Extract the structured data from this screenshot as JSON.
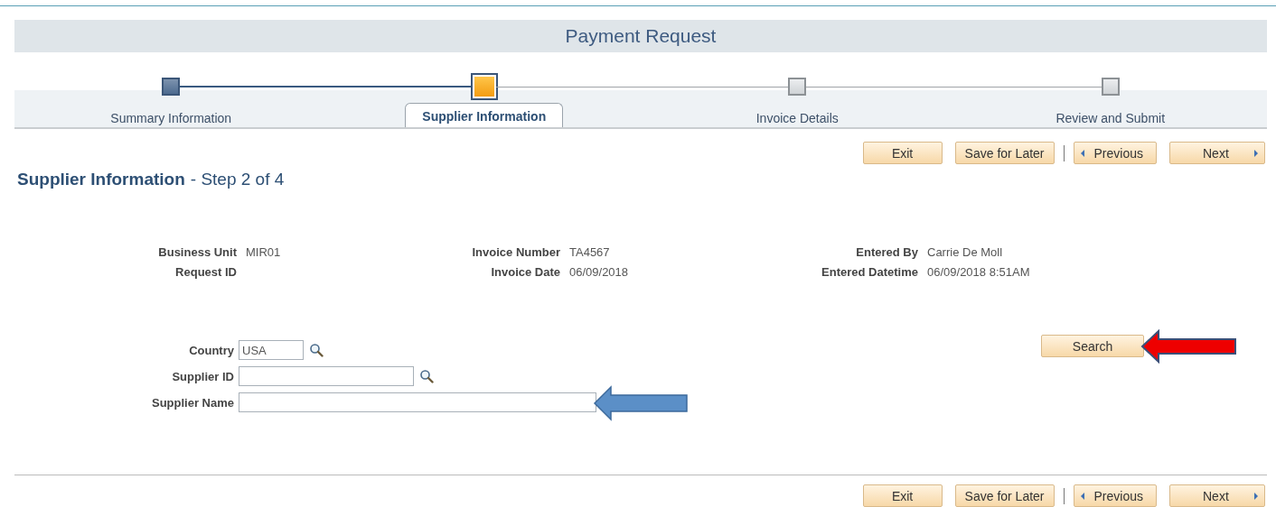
{
  "page_title": "Payment Request",
  "steps": [
    {
      "label": "Summary Information",
      "kind": "done",
      "selected": false
    },
    {
      "label": "Supplier Information",
      "kind": "current",
      "selected": true
    },
    {
      "label": "Invoice Details",
      "kind": "todo",
      "selected": false
    },
    {
      "label": "Review and Submit",
      "kind": "todo",
      "selected": false
    }
  ],
  "top_buttons": [
    {
      "label": "Exit",
      "kind": "plain"
    },
    {
      "label": "Save for Later",
      "kind": "plain"
    },
    {
      "label": "Previous",
      "kind": "prev"
    },
    {
      "label": "Next",
      "kind": "next"
    }
  ],
  "heading": {
    "title": "Supplier Information",
    "subtitle": "- Step 2 of 4"
  },
  "info": [
    {
      "label": "Business Unit",
      "value": "MIR01"
    },
    {
      "label": "Invoice Number",
      "value": "TA4567"
    },
    {
      "label": "Entered By",
      "value": "Carrie De Moll"
    },
    {
      "label": "Request ID"
    },
    {
      "label": "Invoice Date",
      "value": "06/09/2018"
    },
    {
      "label": "Entered Datetime",
      "value": "06/09/2018  8:51AM"
    }
  ],
  "form": [
    {
      "label": "Country",
      "value": "USA",
      "kind": "lookup"
    },
    {
      "label": "Supplier ID",
      "kind": "lookup"
    },
    {
      "label": "Supplier Name",
      "kind": "text"
    }
  ],
  "search_button": "Search",
  "bottom_buttons": [
    {
      "label": "Exit",
      "kind": "plain"
    },
    {
      "label": "Save for Later",
      "kind": "plain"
    },
    {
      "label": "Previous",
      "kind": "prev"
    },
    {
      "label": "Next",
      "kind": "next"
    }
  ]
}
